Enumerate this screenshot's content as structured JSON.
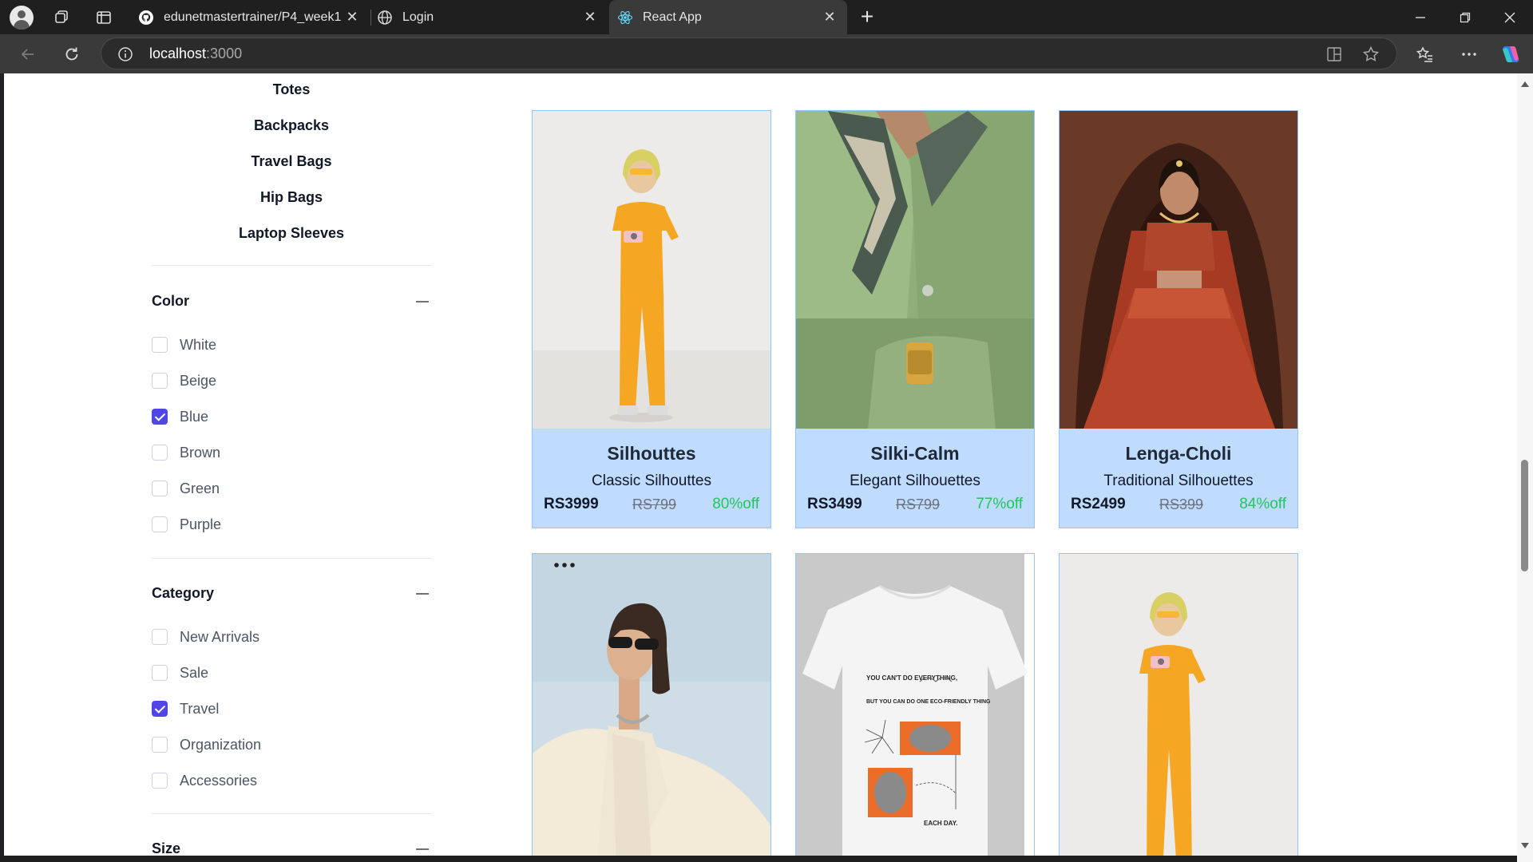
{
  "browser": {
    "tabs": [
      {
        "title": "edunetmastertrainer/P4_week1",
        "favicon": "github-icon"
      },
      {
        "title": "Login",
        "favicon": "globe-icon"
      },
      {
        "title": "React App",
        "favicon": "react-icon",
        "active": true
      }
    ],
    "address": {
      "host": "localhost",
      "port": ":3000"
    }
  },
  "sidebar": {
    "subcategories": [
      "Totes",
      "Backpacks",
      "Travel Bags",
      "Hip Bags",
      "Laptop Sleeves"
    ],
    "filters": [
      {
        "title": "Color",
        "options": [
          {
            "label": "White",
            "checked": false
          },
          {
            "label": "Beige",
            "checked": false
          },
          {
            "label": "Blue",
            "checked": true
          },
          {
            "label": "Brown",
            "checked": false
          },
          {
            "label": "Green",
            "checked": false
          },
          {
            "label": "Purple",
            "checked": false
          }
        ]
      },
      {
        "title": "Category",
        "options": [
          {
            "label": "New Arrivals",
            "checked": false
          },
          {
            "label": "Sale",
            "checked": false
          },
          {
            "label": "Travel",
            "checked": true
          },
          {
            "label": "Organization",
            "checked": false
          },
          {
            "label": "Accessories",
            "checked": false
          }
        ]
      },
      {
        "title": "Size",
        "options": []
      }
    ]
  },
  "products": [
    {
      "name": "Silhouttes",
      "description": "Classic Silhouttes",
      "price": "RS3999",
      "old_price": "RS799",
      "discount": "80%off",
      "image": "woman-yellow-jumpsuit-camera"
    },
    {
      "name": "Silki-Calm",
      "description": "Elegant Silhouettes",
      "price": "RS3499",
      "old_price": "RS799",
      "discount": "77%off",
      "image": "green-shirt-scarf-watch"
    },
    {
      "name": "Lenga-Choli",
      "description": "Traditional Silhouettes",
      "price": "RS2499",
      "old_price": "RS399",
      "discount": "84%off",
      "image": "woman-red-lehenga"
    },
    {
      "name": "",
      "description": "",
      "price": "",
      "old_price": "",
      "discount": "",
      "image": "woman-sunglasses-white-blazer"
    },
    {
      "name": "",
      "description": "",
      "price": "",
      "old_price": "",
      "discount": "",
      "image": "white-tshirt-print",
      "print_text": {
        "line1": "YOU CAN'T DO EVERYTHING,",
        "line2": "BUT YOU CAN DO ONE ECO-FRIENDLY THING",
        "line3": "EACH DAY."
      }
    },
    {
      "name": "",
      "description": "",
      "price": "",
      "old_price": "",
      "discount": "",
      "image": "woman-yellow-jumpsuit-camera"
    }
  ],
  "colors": {
    "accent": "#4f46e5",
    "card_info_bg": "#bfdbfe",
    "card_border": "#93c5fd",
    "discount": "#22c55e"
  }
}
